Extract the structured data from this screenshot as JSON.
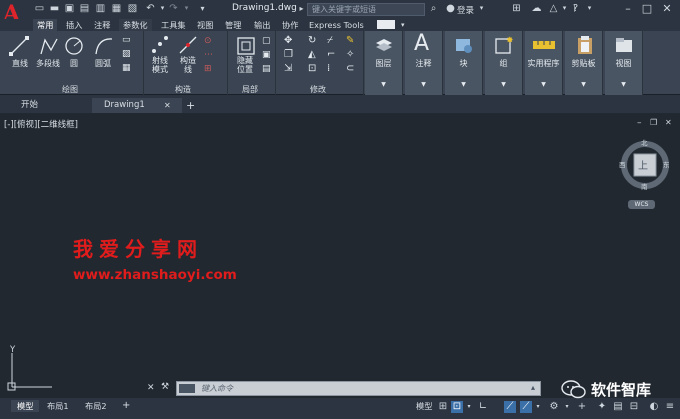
{
  "app": {
    "logo_letter": "A",
    "document_title": "Drawing1.dwg",
    "search_placeholder": "键入关键字或短语",
    "login_label": "登录"
  },
  "ribbon_tabs": [
    {
      "label": "常用",
      "active": true
    },
    {
      "label": "插入"
    },
    {
      "label": "注释"
    },
    {
      "label": "参数化"
    },
    {
      "label": "工具集"
    },
    {
      "label": "视图"
    },
    {
      "label": "管理"
    },
    {
      "label": "输出"
    },
    {
      "label": "协作"
    },
    {
      "label": "Express Tools"
    }
  ],
  "draw_group": {
    "label": "绘图",
    "buttons": [
      "直线",
      "多段线",
      "圆",
      "圆弧"
    ]
  },
  "construct_group": {
    "label": "构造",
    "buttons": [
      "射线\n模式",
      "构造\n线"
    ]
  },
  "layer_group": {
    "label": "局部",
    "buttons": [
      "隐藏\n位置"
    ]
  },
  "modify_group": {
    "label": "修改"
  },
  "big_tiles": [
    {
      "label": "图层",
      "icon": "layers-icon"
    },
    {
      "label": "注释",
      "icon": "text-icon"
    },
    {
      "label": "块",
      "icon": "block-icon"
    },
    {
      "label": "组",
      "icon": "group-icon"
    },
    {
      "label": "实用程序",
      "icon": "measure-icon"
    },
    {
      "label": "剪贴板",
      "icon": "clipboard-icon"
    },
    {
      "label": "视图",
      "icon": "view-icon"
    }
  ],
  "file_tabs": [
    "开始",
    "Drawing1"
  ],
  "viewport_label": "[-][俯视][二维线框]",
  "viewcube": {
    "top_label": "上",
    "north": "北",
    "south": "南",
    "east": "东",
    "west": "西",
    "wcs_label": "WCS"
  },
  "ucs": {
    "y_label": "Y"
  },
  "watermark": {
    "cn": "我爱分享网",
    "url": "www.zhanshaoyi.com"
  },
  "command_line": {
    "placeholder": "键入命令"
  },
  "layout_tabs": [
    "模型",
    "布局1",
    "布局2"
  ],
  "status_model_label": "模型",
  "weixin_badge": "软件智库",
  "colors": {
    "accent": "#e0242b",
    "ribbon_bg": "#3a4452",
    "canvas_bg": "#212830"
  }
}
